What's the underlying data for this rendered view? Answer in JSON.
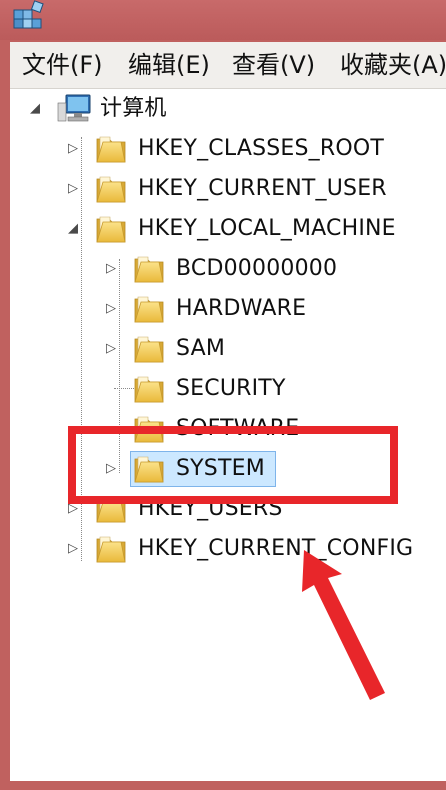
{
  "menu": {
    "file": "文件(F)",
    "edit": "编辑(E)",
    "view": "查看(V)",
    "favorites": "收藏夹(A)"
  },
  "tree": {
    "computer": "计算机",
    "hkcr": "HKEY_CLASSES_ROOT",
    "hkcu": "HKEY_CURRENT_USER",
    "hklm": "HKEY_LOCAL_MACHINE",
    "bcd": "BCD00000000",
    "hardware": "HARDWARE",
    "sam": "SAM",
    "security": "SECURITY",
    "software": "SOFTWARE",
    "system": "SYSTEM",
    "hku": "HKEY_USERS",
    "hkcc": "HKEY_CURRENT_CONFIG"
  },
  "icons": {
    "app": "registry-editor-icon",
    "computer": "computer-icon",
    "folder": "folder-icon"
  },
  "colors": {
    "highlight": "#e8262a",
    "selection": "#cce8ff",
    "folder": "#f3cf57"
  }
}
